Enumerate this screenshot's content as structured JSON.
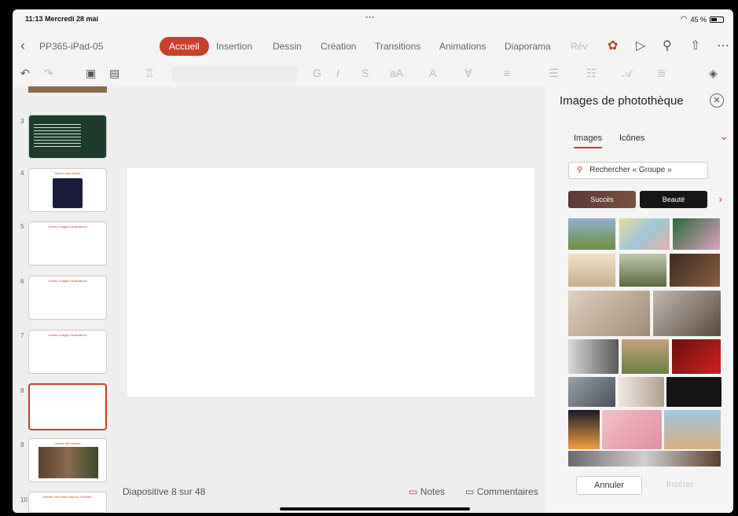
{
  "status": {
    "time": "11:13  Mercredi 28 mai",
    "dots": "•••",
    "battery": "45 %"
  },
  "header": {
    "doc_name": "PP365-iPad-05",
    "tabs": [
      "Accueil",
      "Insertion",
      "Dessin",
      "Création",
      "Transitions",
      "Animations",
      "Diaporama",
      "Rév"
    ],
    "active_tab": "Accueil"
  },
  "thumbnails": [
    {
      "num": "3",
      "title": ""
    },
    {
      "num": "4",
      "title": "Insérer des icônes"
    },
    {
      "num": "5",
      "title": "Icônes, images, illustrations"
    },
    {
      "num": "6",
      "title": "Icônes, images, illustrations"
    },
    {
      "num": "7",
      "title": "Icônes, images, illustrations"
    },
    {
      "num": "8",
      "title": ""
    },
    {
      "num": "9",
      "title": "Insérer des photos"
    },
    {
      "num": "10",
      "title": "Insérer une photo depuis un fichier"
    }
  ],
  "bottom": {
    "slide_count": "Diapositive 8 sur 48",
    "notes": "Notes",
    "comments": "Commentaires"
  },
  "panel": {
    "title": "Images de photothèque",
    "tab_images": "Images",
    "tab_icons": "Icônes",
    "search_placeholder": "Rechercher « Groupe »",
    "chip1": "Succès",
    "chip2": "Beauté",
    "cancel": "Annuler",
    "insert": "Insérer"
  },
  "colors": {
    "accent": "#c8412b"
  }
}
